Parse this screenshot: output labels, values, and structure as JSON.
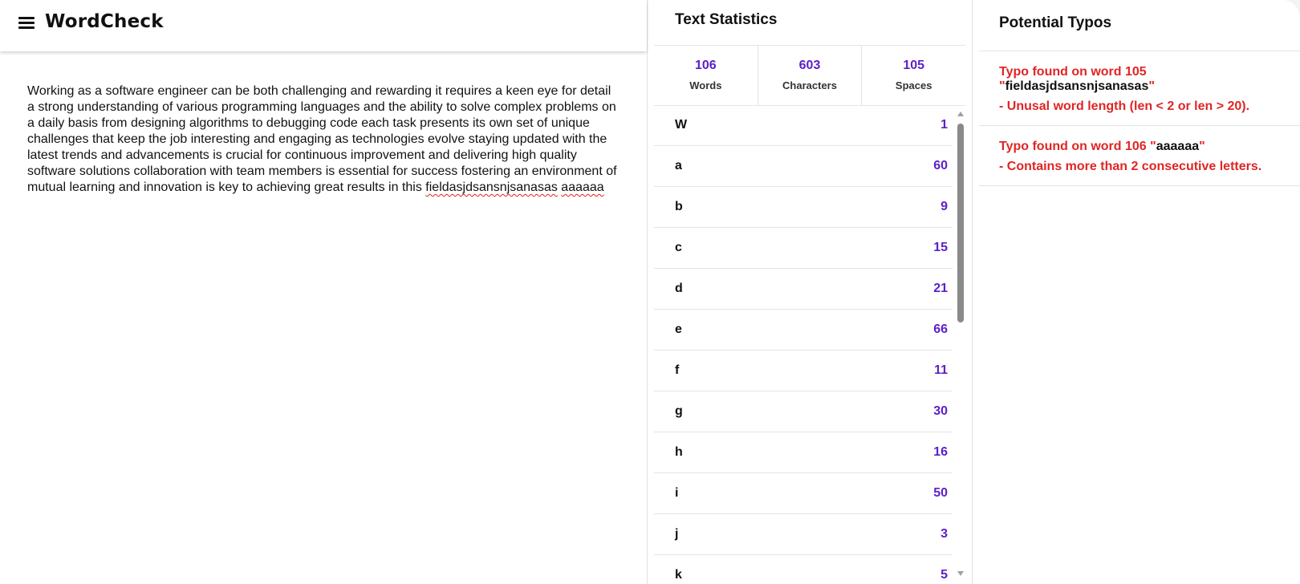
{
  "app": {
    "title": "WordCheck"
  },
  "editor": {
    "text_plain": "Working as a software engineer can be both challenging and rewarding it requires a keen eye for detail a strong understanding of various programming languages and the ability to solve complex problems on a daily basis from designing algorithms to debugging code each task presents its own set of unique challenges that keep the job interesting and engaging as technologies evolve staying updated with the latest trends and advancements is crucial for continuous improvement and delivering high quality software solutions collaboration with team members is essential for success fostering an environment of mutual learning and innovation is key to achieving great results in this",
    "flagged_words": [
      "fieldasjdsansnjsanasas",
      "aaaaaa"
    ]
  },
  "stats": {
    "title": "Text Statistics",
    "summary": [
      {
        "value": "106",
        "label": "Words"
      },
      {
        "value": "603",
        "label": "Characters"
      },
      {
        "value": "105",
        "label": "Spaces"
      }
    ],
    "letters": [
      {
        "char": "W",
        "count": "1"
      },
      {
        "char": "a",
        "count": "60"
      },
      {
        "char": "b",
        "count": "9"
      },
      {
        "char": "c",
        "count": "15"
      },
      {
        "char": "d",
        "count": "21"
      },
      {
        "char": "e",
        "count": "66"
      },
      {
        "char": "f",
        "count": "11"
      },
      {
        "char": "g",
        "count": "30"
      },
      {
        "char": "h",
        "count": "16"
      },
      {
        "char": "i",
        "count": "50"
      },
      {
        "char": "j",
        "count": "3"
      },
      {
        "char": "k",
        "count": "5"
      }
    ]
  },
  "typos": {
    "title": "Potential Typos",
    "items": [
      {
        "prefix": "Typo found on word 105 \"",
        "word": "fieldasjdsansnjsanasas",
        "suffix": "\"",
        "reason": "- Unusal word length (len < 2 or len > 20)."
      },
      {
        "prefix": "Typo found on word 106 \"",
        "word": "aaaaaa",
        "suffix": "\"",
        "reason": "- Contains more than 2 consecutive letters."
      }
    ]
  },
  "colors": {
    "accent": "#5b21c6",
    "error": "#e02525"
  }
}
